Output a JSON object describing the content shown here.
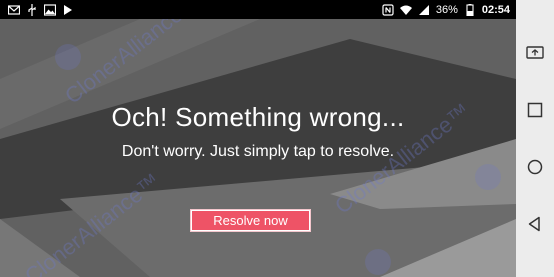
{
  "status_bar": {
    "left_icons": [
      "gmail-icon",
      "usb-icon",
      "image-icon",
      "download-icon"
    ],
    "right_icons": [
      "nfc-icon",
      "wifi-icon",
      "signal-icon",
      "battery-icon"
    ],
    "battery": "36%",
    "time": "02:54"
  },
  "main": {
    "title": "Och! Something wrong...",
    "subtitle": "Don't worry. Just simply tap to resolve.",
    "resolve_button": "Resolve now",
    "watermark": "ClonerAlliance™",
    "colors": {
      "background": "#5f5f5f",
      "button": "#ee5366",
      "text": "#ffffff"
    }
  },
  "nav_bar": {
    "buttons": [
      "screen-cast-icon",
      "recents-icon",
      "home-icon",
      "back-icon"
    ]
  }
}
